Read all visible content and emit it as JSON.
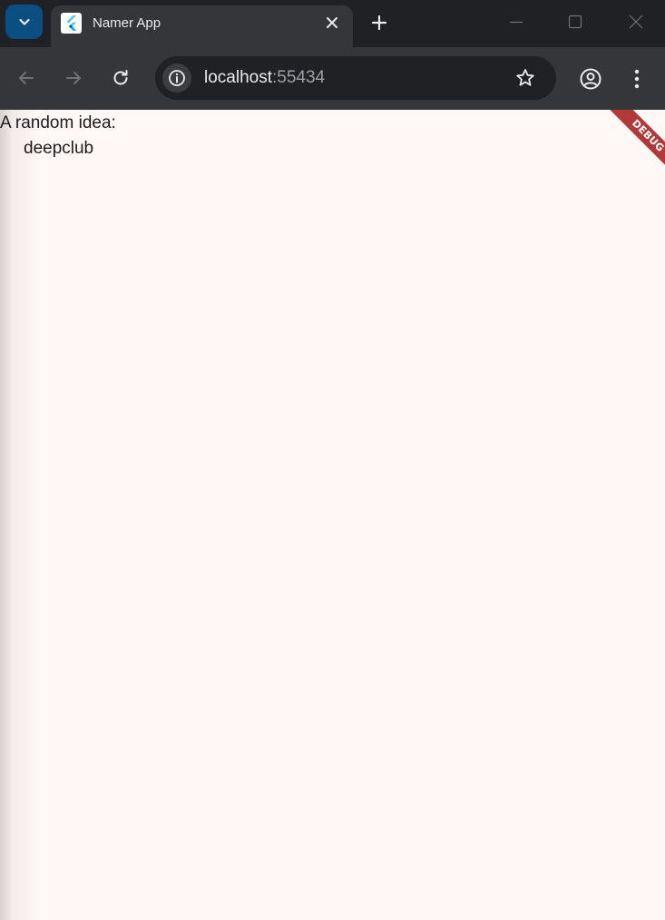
{
  "browser": {
    "tab": {
      "title": "Namer App",
      "favicon": "flutter-icon"
    },
    "toolbar": {
      "url_host": "localhost",
      "url_port": ":55434"
    },
    "icons": {
      "tab_search": "chevron-down-icon",
      "tab_close": "close-icon",
      "new_tab": "plus-icon",
      "back": "back-arrow-icon",
      "forward": "forward-arrow-icon",
      "reload": "reload-icon",
      "site_info": "info-icon",
      "bookmark": "star-icon",
      "profile": "profile-icon",
      "menu": "kebab-menu-icon",
      "minimize": "minimize-icon",
      "maximize": "maximize-icon",
      "close_window": "close-window-icon"
    }
  },
  "app": {
    "intro_text": "A random idea:",
    "idea_text": "deepclub",
    "debug_banner": "DEBUG"
  },
  "colors": {
    "page_background": "#fff8f6",
    "debug_banner": "#b03a3a",
    "tab_search_accent": "#0b4f82"
  }
}
